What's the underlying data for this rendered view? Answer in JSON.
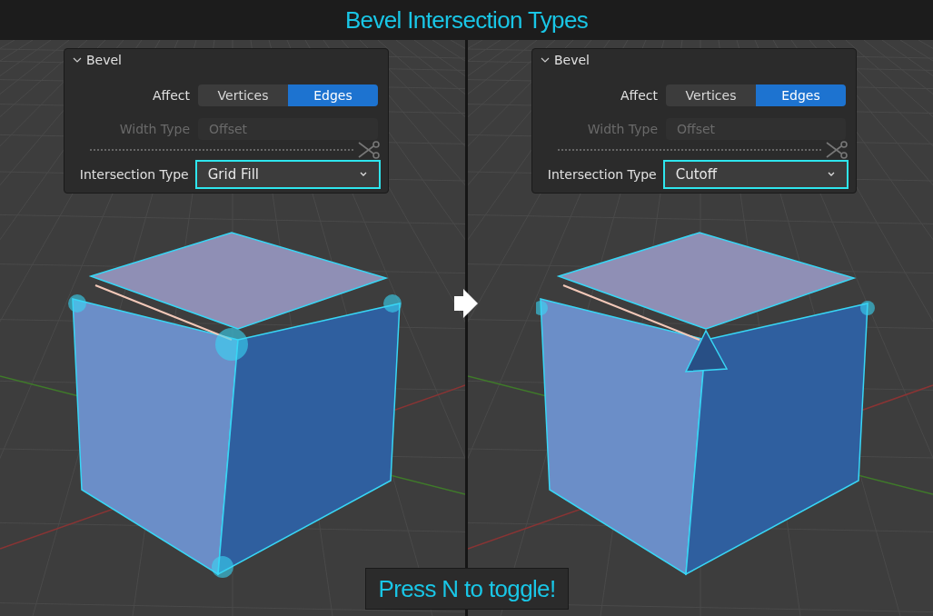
{
  "title": "Bevel Intersection Types",
  "viewports": [
    {
      "panel": {
        "header": "Bevel",
        "expanded": true,
        "affect_label": "Affect",
        "affect_options": [
          {
            "label": "Vertices",
            "selected": false
          },
          {
            "label": "Edges",
            "selected": true
          }
        ],
        "width_type_label": "Width Type",
        "width_type_value": "Offset",
        "width_type_disabled": true,
        "intersection_label": "Intersection Type",
        "intersection_value": "Grid Fill",
        "intersection_highlighted": true
      },
      "cube": {
        "kind": "grid_fill"
      }
    },
    {
      "panel": {
        "header": "Bevel",
        "expanded": true,
        "affect_label": "Affect",
        "affect_options": [
          {
            "label": "Vertices",
            "selected": false
          },
          {
            "label": "Edges",
            "selected": true
          }
        ],
        "width_type_label": "Width Type",
        "width_type_value": "Offset",
        "width_type_disabled": true,
        "intersection_label": "Intersection Type",
        "intersection_value": "Cutoff",
        "intersection_highlighted": true
      },
      "cube": {
        "kind": "cutoff"
      }
    }
  ],
  "hint": "Press N to toggle!"
}
